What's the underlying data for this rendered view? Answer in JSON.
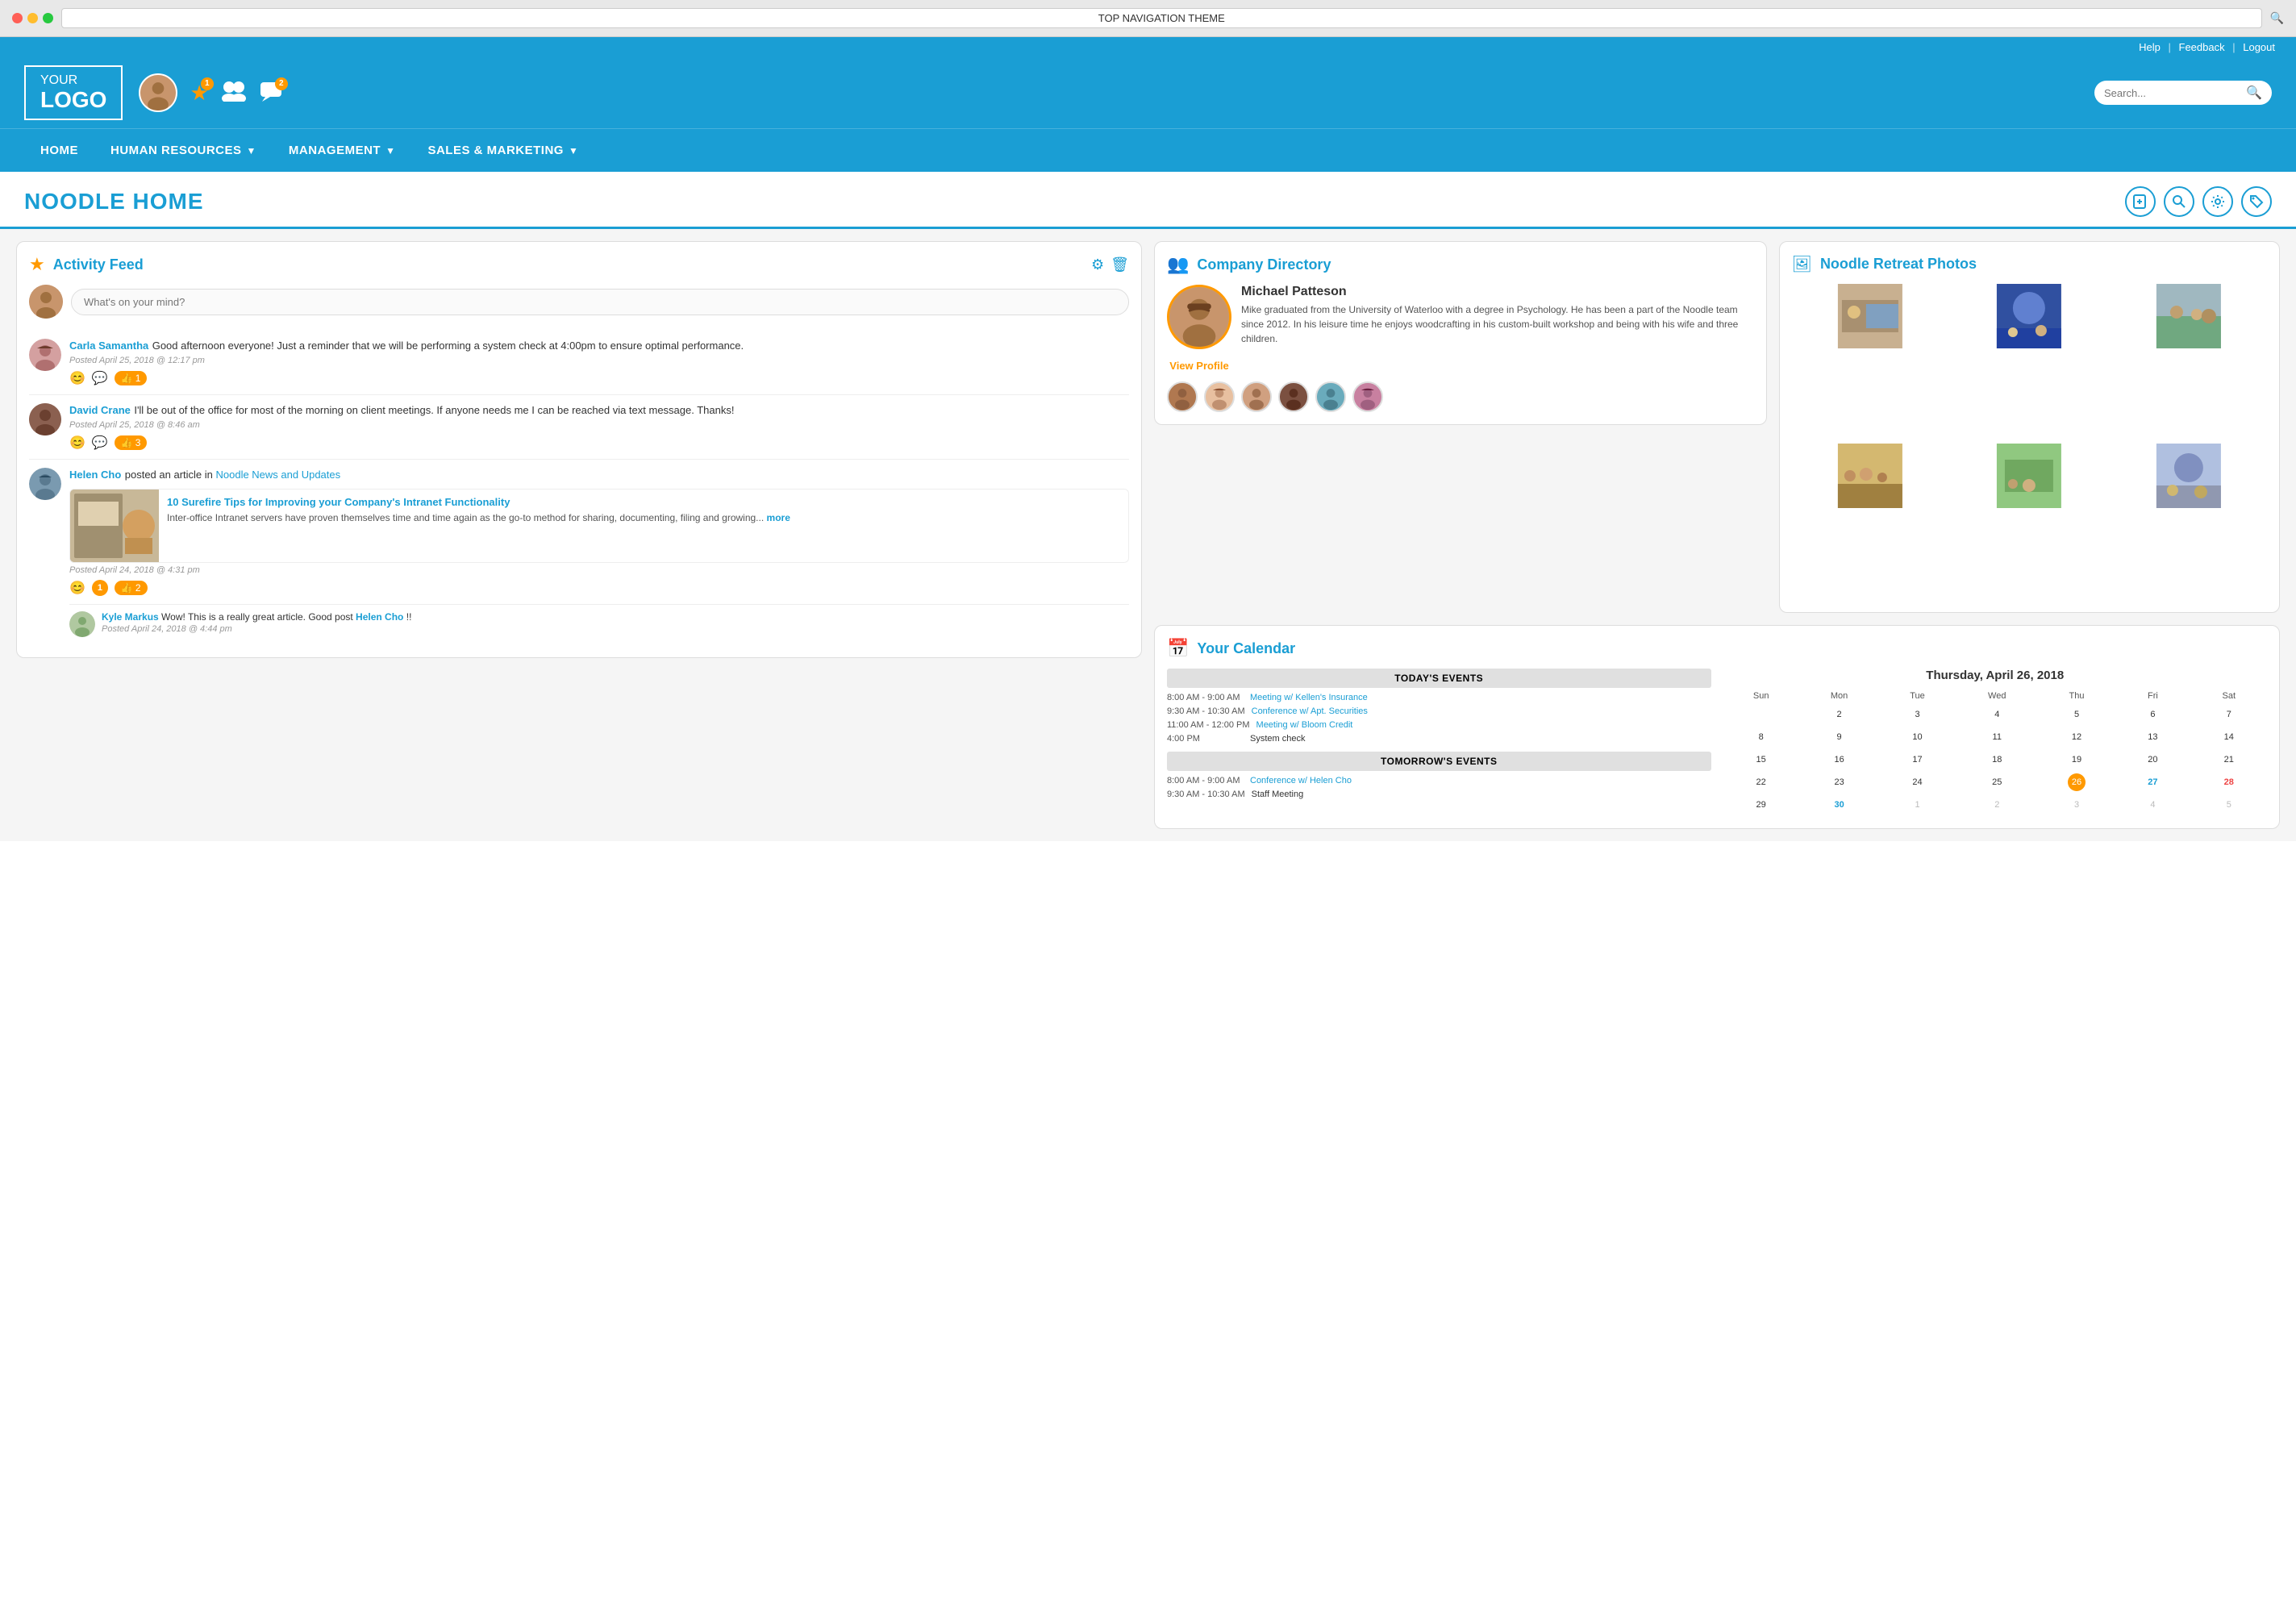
{
  "browser": {
    "title": "TOP NAVIGATION THEME"
  },
  "utility_bar": {
    "help": "Help",
    "feedback": "Feedback",
    "logout": "Logout"
  },
  "logo": {
    "your": "YOUR",
    "logo": "LOGO"
  },
  "header": {
    "notifications_star": "1",
    "notifications_chat": "2",
    "search_placeholder": "Search..."
  },
  "nav": {
    "items": [
      {
        "label": "HOME",
        "has_dropdown": false
      },
      {
        "label": "HUMAN RESOURCES",
        "has_dropdown": true
      },
      {
        "label": "MANAGEMENT",
        "has_dropdown": true
      },
      {
        "label": "SALES & MARKETING",
        "has_dropdown": true
      }
    ]
  },
  "page": {
    "title": "NOODLE HOME"
  },
  "activity_feed": {
    "title": "Activity Feed",
    "compose_placeholder": "What's on your mind?",
    "posts": [
      {
        "author": "Carla Samantha",
        "text": "Good afternoon everyone! Just a reminder that we will be performing a system check at 4:00pm to ensure optimal performance.",
        "time": "Posted April 25, 2018 @ 12:17 pm",
        "likes": "1"
      },
      {
        "author": "David Crane",
        "text": "I'll be out of the office for most of the morning on client meetings. If anyone needs me I can be reached via text message. Thanks!",
        "time": "Posted April 25, 2018 @ 8:46 am",
        "likes": "3"
      },
      {
        "author": "Helen Cho",
        "link_text": "Noodle News and Updates",
        "article_title": "10 Surefire Tips for Improving your Company's Intranet Functionality",
        "article_desc": "Inter-office Intranet servers have proven themselves time and time again as the go-to method for sharing, documenting, filing and growing...",
        "article_more": "more",
        "time": "Posted April 24, 2018 @ 4:31 pm",
        "likes": "2",
        "comment_author": "Kyle Markus",
        "comment_text": "Wow! This is a really great article. Good post ",
        "comment_link": "Helen Cho",
        "comment_time": "Posted April 24, 2018 @ 4:44 pm",
        "comment_suffix": "!!"
      }
    ]
  },
  "company_directory": {
    "title": "Company Directory",
    "person": {
      "name": "Michael Patteson",
      "bio": "Mike graduated from the University of Waterloo with a degree in Psychology. He has been a part of the Noodle team since 2012. In his leisure time he enjoys woodcrafting in his custom-built workshop and being with his wife and three children.",
      "view_profile": "View Profile"
    }
  },
  "noodle_retreat": {
    "title": "Noodle Retreat Photos"
  },
  "calendar": {
    "title": "Your Calendar",
    "date_header": "Thursday, April 26, 2018",
    "today_events_header": "TODAY'S EVENTS",
    "tomorrow_events_header": "TOMORROW'S EVENTS",
    "today_events": [
      {
        "time": "8:00 AM - 9:00 AM",
        "name": "Meeting w/ Kellen's Insurance",
        "is_link": true
      },
      {
        "time": "9:30 AM - 10:30 AM",
        "name": "Conference w/ Apt. Securities",
        "is_link": true
      },
      {
        "time": "11:00 AM - 12:00 PM",
        "name": "Meeting w/ Bloom Credit",
        "is_link": true
      },
      {
        "time": "4:00 PM",
        "name": "System check",
        "is_link": false
      }
    ],
    "tomorrow_events": [
      {
        "time": "8:00 AM - 9:00 AM",
        "name": "Conference w/ Helen Cho",
        "is_link": true
      },
      {
        "time": "9:30 AM - 10:30 AM",
        "name": "Staff Meeting",
        "is_link": false
      }
    ],
    "days_of_week": [
      "Sun",
      "Mon",
      "Tue",
      "Wed",
      "Thu",
      "Fri",
      "Sat"
    ],
    "weeks": [
      [
        "",
        "2",
        "3",
        "4",
        "5",
        "6",
        "7"
      ],
      [
        "8",
        "9",
        "10",
        "11",
        "12",
        "13",
        "14"
      ],
      [
        "15",
        "16",
        "17",
        "18",
        "19",
        "20",
        "21"
      ],
      [
        "22",
        "23",
        "24",
        "25",
        "26",
        "27",
        "28"
      ],
      [
        "29",
        "30",
        "1",
        "2",
        "3",
        "4",
        "5"
      ]
    ],
    "today_date": "26",
    "highlight_blue_dates": [
      "27",
      "30"
    ],
    "highlight_red_dates": [
      "28"
    ],
    "other_month_dates": [
      "1",
      "2",
      "3",
      "4",
      "5"
    ]
  }
}
